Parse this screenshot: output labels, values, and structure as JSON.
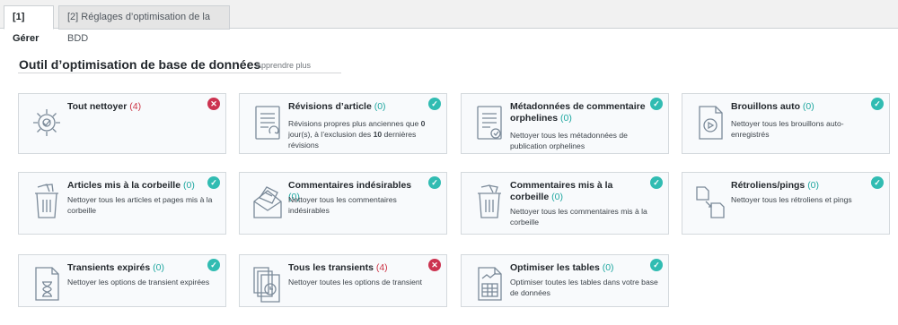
{
  "tabs": [
    {
      "label": "[1] Gérer"
    },
    {
      "label": "[2] Réglages d’optimisation de la BDD"
    }
  ],
  "header": {
    "title": "Outil d’optimisation de base de données",
    "learn_more": "Apprendre plus"
  },
  "colors": {
    "ok": "#31bcb2",
    "error": "#cc3350",
    "count_good": "#1fa7a0",
    "count_bad": "#cc3344"
  },
  "cards": [
    {
      "title": "Tout nettoyer",
      "count": "(4)",
      "status": "error",
      "icon": "gear-clean-icon",
      "desc": ""
    },
    {
      "title": "Révisions d’article",
      "count": "(0)",
      "status": "ok",
      "icon": "document-revisions-icon",
      "desc_parts": [
        "Révisions propres plus anciennes que ",
        "0",
        " jour(s), à l’exclusion des ",
        "10",
        " dernières révisions"
      ]
    },
    {
      "title": "Métadonnées de commentaire orphelines",
      "count": "(0)",
      "status": "ok",
      "icon": "document-meta-icon",
      "desc": "Nettoyer tous les métadonnées de publication orphelines"
    },
    {
      "title": "Brouillons auto",
      "count": "(0)",
      "status": "ok",
      "icon": "draft-gear-icon",
      "desc": "Nettoyer tous les brouillons auto-enregistrés"
    },
    {
      "title": "Articles mis à la corbeille",
      "count": "(0)",
      "status": "ok",
      "icon": "trash-articles-icon",
      "desc": "Nettoyer tous les articles et pages mis à la corbeille"
    },
    {
      "title": "Commentaires indésirables",
      "count": "(0)",
      "status": "ok",
      "icon": "spam-envelope-icon",
      "desc": "Nettoyer tous les commentaires indésirables"
    },
    {
      "title": "Commentaires mis à la corbeille",
      "count": "(0)",
      "status": "ok",
      "icon": "trash-comments-icon",
      "desc": "Nettoyer tous les commentaires mis à la corbeille"
    },
    {
      "title": "Rétroliens/pings",
      "count": "(0)",
      "status": "ok",
      "icon": "pingback-icon",
      "desc": "Nettoyer tous les rétroliens et pings"
    },
    {
      "title": "Transients expirés",
      "count": "(0)",
      "status": "ok",
      "icon": "hourglass-icon",
      "desc": "Nettoyer les options de transient expirées"
    },
    {
      "title": "Tous les transients",
      "count": "(4)",
      "status": "error",
      "icon": "stacked-clock-icon",
      "desc": "Nettoyer toutes les options de transient"
    },
    {
      "title": "Optimiser les tables",
      "count": "(0)",
      "status": "ok",
      "icon": "table-chart-icon",
      "desc": "Optimiser toutes les tables dans votre base de données"
    }
  ]
}
